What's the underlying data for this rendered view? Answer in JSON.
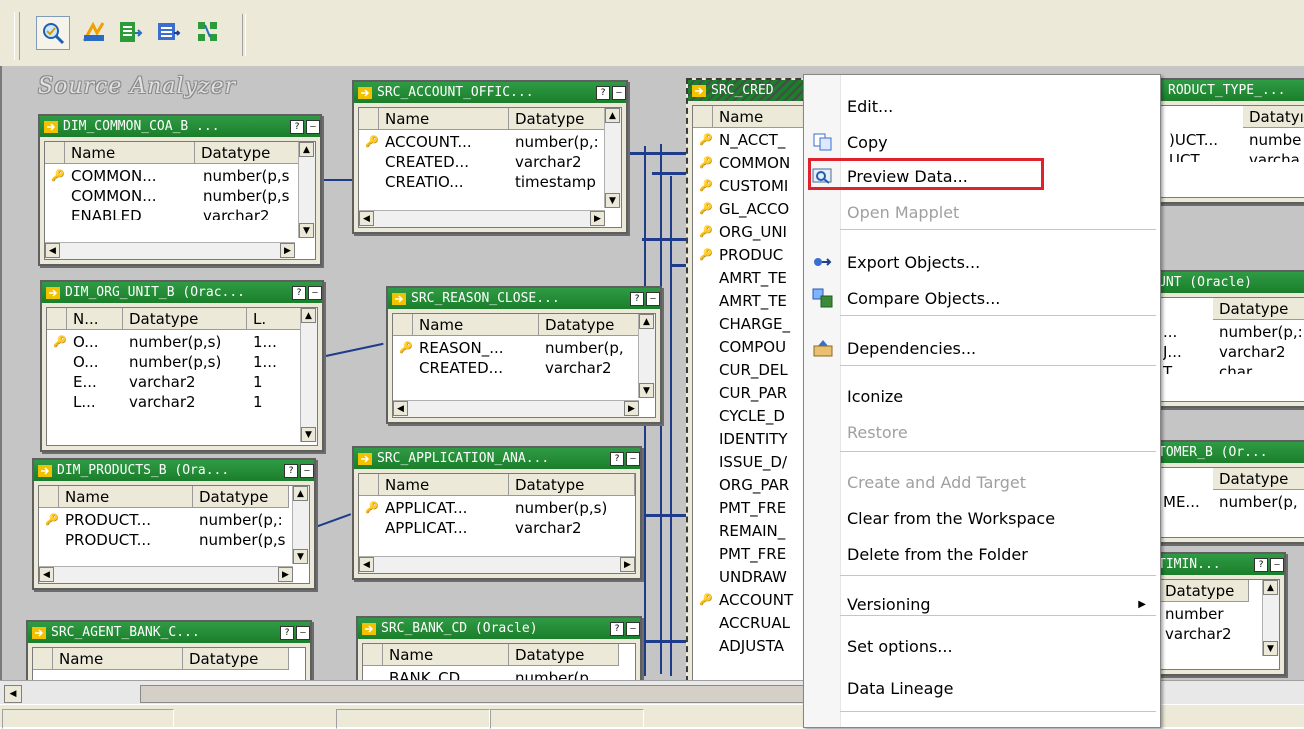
{
  "workspace_title": "Source Analyzer",
  "toolbar": {
    "tools": [
      "source-analyzer-icon",
      "target-designer-icon",
      "transformation-developer-icon",
      "mapplet-designer-icon",
      "mapping-designer-icon"
    ]
  },
  "tables": {
    "dim_common_coa": {
      "title": "DIM_COMMON_COA_B ...",
      "cols": [
        "Name",
        "Datatype"
      ],
      "rows": [
        [
          "COMMON...",
          "number(p,s"
        ],
        [
          "COMMON...",
          "number(p,s"
        ],
        [
          "ENABLED",
          "varchar2"
        ]
      ]
    },
    "src_account_offic": {
      "title": "SRC_ACCOUNT_OFFIC...",
      "cols": [
        "Name",
        "Datatype"
      ],
      "rows": [
        [
          "ACCOUNT...",
          "number(p,:"
        ],
        [
          "CREATED...",
          "varchar2"
        ],
        [
          "CREATIO...",
          "timestamp"
        ]
      ]
    },
    "dim_org_unit": {
      "title": "DIM_ORG_UNIT_B (Orac...",
      "cols": [
        "N...",
        "Datatype",
        "L."
      ],
      "rows": [
        [
          "O...",
          "number(p,s)",
          "1..."
        ],
        [
          "O...",
          "number(p,s)",
          "1..."
        ],
        [
          "E...",
          "varchar2",
          "1"
        ],
        [
          "L...",
          "varchar2",
          "1"
        ]
      ]
    },
    "src_reason_close": {
      "title": "SRC_REASON_CLOSE...",
      "cols": [
        "Name",
        "Datatype"
      ],
      "rows": [
        [
          "REASON_...",
          "number(p,"
        ],
        [
          "CREATED...",
          "varchar2"
        ]
      ]
    },
    "dim_products": {
      "title": "DIM_PRODUCTS_B (Ora...",
      "cols": [
        "Name",
        "Datatype"
      ],
      "rows": [
        [
          "PRODUCT...",
          "number(p,:"
        ],
        [
          "PRODUCT...",
          "number(p,s"
        ]
      ]
    },
    "src_application": {
      "title": "SRC_APPLICATION_ANA...",
      "cols": [
        "Name",
        "Datatype"
      ],
      "rows": [
        [
          "APPLICAT...",
          "number(p,s)"
        ],
        [
          "APPLICAT...",
          "varchar2"
        ]
      ]
    },
    "src_agent_bank": {
      "title": "SRC_AGENT_BANK_C...",
      "cols": [
        "Name",
        "Datatype"
      ],
      "rows": []
    },
    "src_bank_cd": {
      "title": "SRC_BANK_CD (Oracle)",
      "cols": [
        "Name",
        "Datatype"
      ],
      "rows": [
        [
          "BANK_CD",
          "number(p,"
        ]
      ]
    },
    "src_cred": {
      "title": "SRC_CRED",
      "cols": [
        "Name"
      ],
      "rows": [
        "N_ACCT_",
        "COMMON",
        "CUSTOMI",
        "GL_ACCO",
        "ORG_UNI",
        "PRODUC",
        "AMRT_TE",
        "AMRT_TE",
        "CHARGE_",
        "COMPOU",
        "CUR_DEL",
        "CUR_PAR",
        "CYCLE_D",
        "IDENTITY",
        "ISSUE_D/",
        "ORG_PAR",
        "PMT_FRE",
        "REMAIN_",
        "PMT_FRE",
        "UNDRAW",
        "ACCOUNT",
        "ACCRUAL",
        "ADJUSTA"
      ]
    },
    "src_product_type": {
      "title": "RODUCT_TYPE_...",
      "cols": [
        "Datatyı"
      ],
      "rows": [
        [
          ")UCT...",
          "numbe"
        ],
        [
          "UCT",
          "varcha"
        ]
      ]
    },
    "right_ount": {
      "title": "UNT (Oracle)",
      "cols": [
        "Datatype"
      ],
      "rows": [
        [
          "...",
          "number(p,:"
        ],
        [
          "J...",
          "varchar2"
        ],
        [
          "T",
          "char"
        ]
      ]
    },
    "right_customer": {
      "title": "TOMER_B (Or...",
      "cols": [
        "Datatype"
      ],
      "rows": [
        [
          "ME...",
          "number(p,"
        ]
      ]
    },
    "right_timin": {
      "title": "TIMIN...",
      "cols": [
        "Datatype"
      ],
      "rows": [
        "number",
        "varchar2"
      ]
    }
  },
  "context_menu": {
    "items": [
      {
        "label": "Edit...",
        "icon": "",
        "disabled": false
      },
      {
        "label": "Copy",
        "icon": "copy-icon",
        "disabled": false
      },
      {
        "label": "Preview Data...",
        "icon": "preview-data-icon",
        "disabled": false
      },
      {
        "label": "Open Mapplet",
        "icon": "",
        "disabled": true
      },
      {
        "label": "Export Objects...",
        "icon": "export-icon",
        "disabled": false
      },
      {
        "label": "Compare Objects...",
        "icon": "compare-icon",
        "disabled": false
      },
      {
        "label": "Dependencies...",
        "icon": "dependencies-icon",
        "disabled": false
      },
      {
        "label": "Iconize",
        "icon": "",
        "disabled": false
      },
      {
        "label": "Restore",
        "icon": "",
        "disabled": true
      },
      {
        "label": "Create and Add Target",
        "icon": "",
        "disabled": true
      },
      {
        "label": "Clear from the Workspace",
        "icon": "",
        "disabled": false
      },
      {
        "label": "Delete from the Folder",
        "icon": "",
        "disabled": false
      },
      {
        "label": "Versioning",
        "icon": "",
        "disabled": false,
        "submenu": true
      },
      {
        "label": "Set options...",
        "icon": "",
        "disabled": false
      },
      {
        "label": "Data Lineage",
        "icon": "",
        "disabled": false
      }
    ],
    "highlighted": "Preview Data..."
  },
  "colors": {
    "header_green": "#1b7e2b",
    "workspace_bg": "#c5c5c5",
    "link_blue": "#1e3c8a",
    "highlight_red": "#e0222d"
  }
}
